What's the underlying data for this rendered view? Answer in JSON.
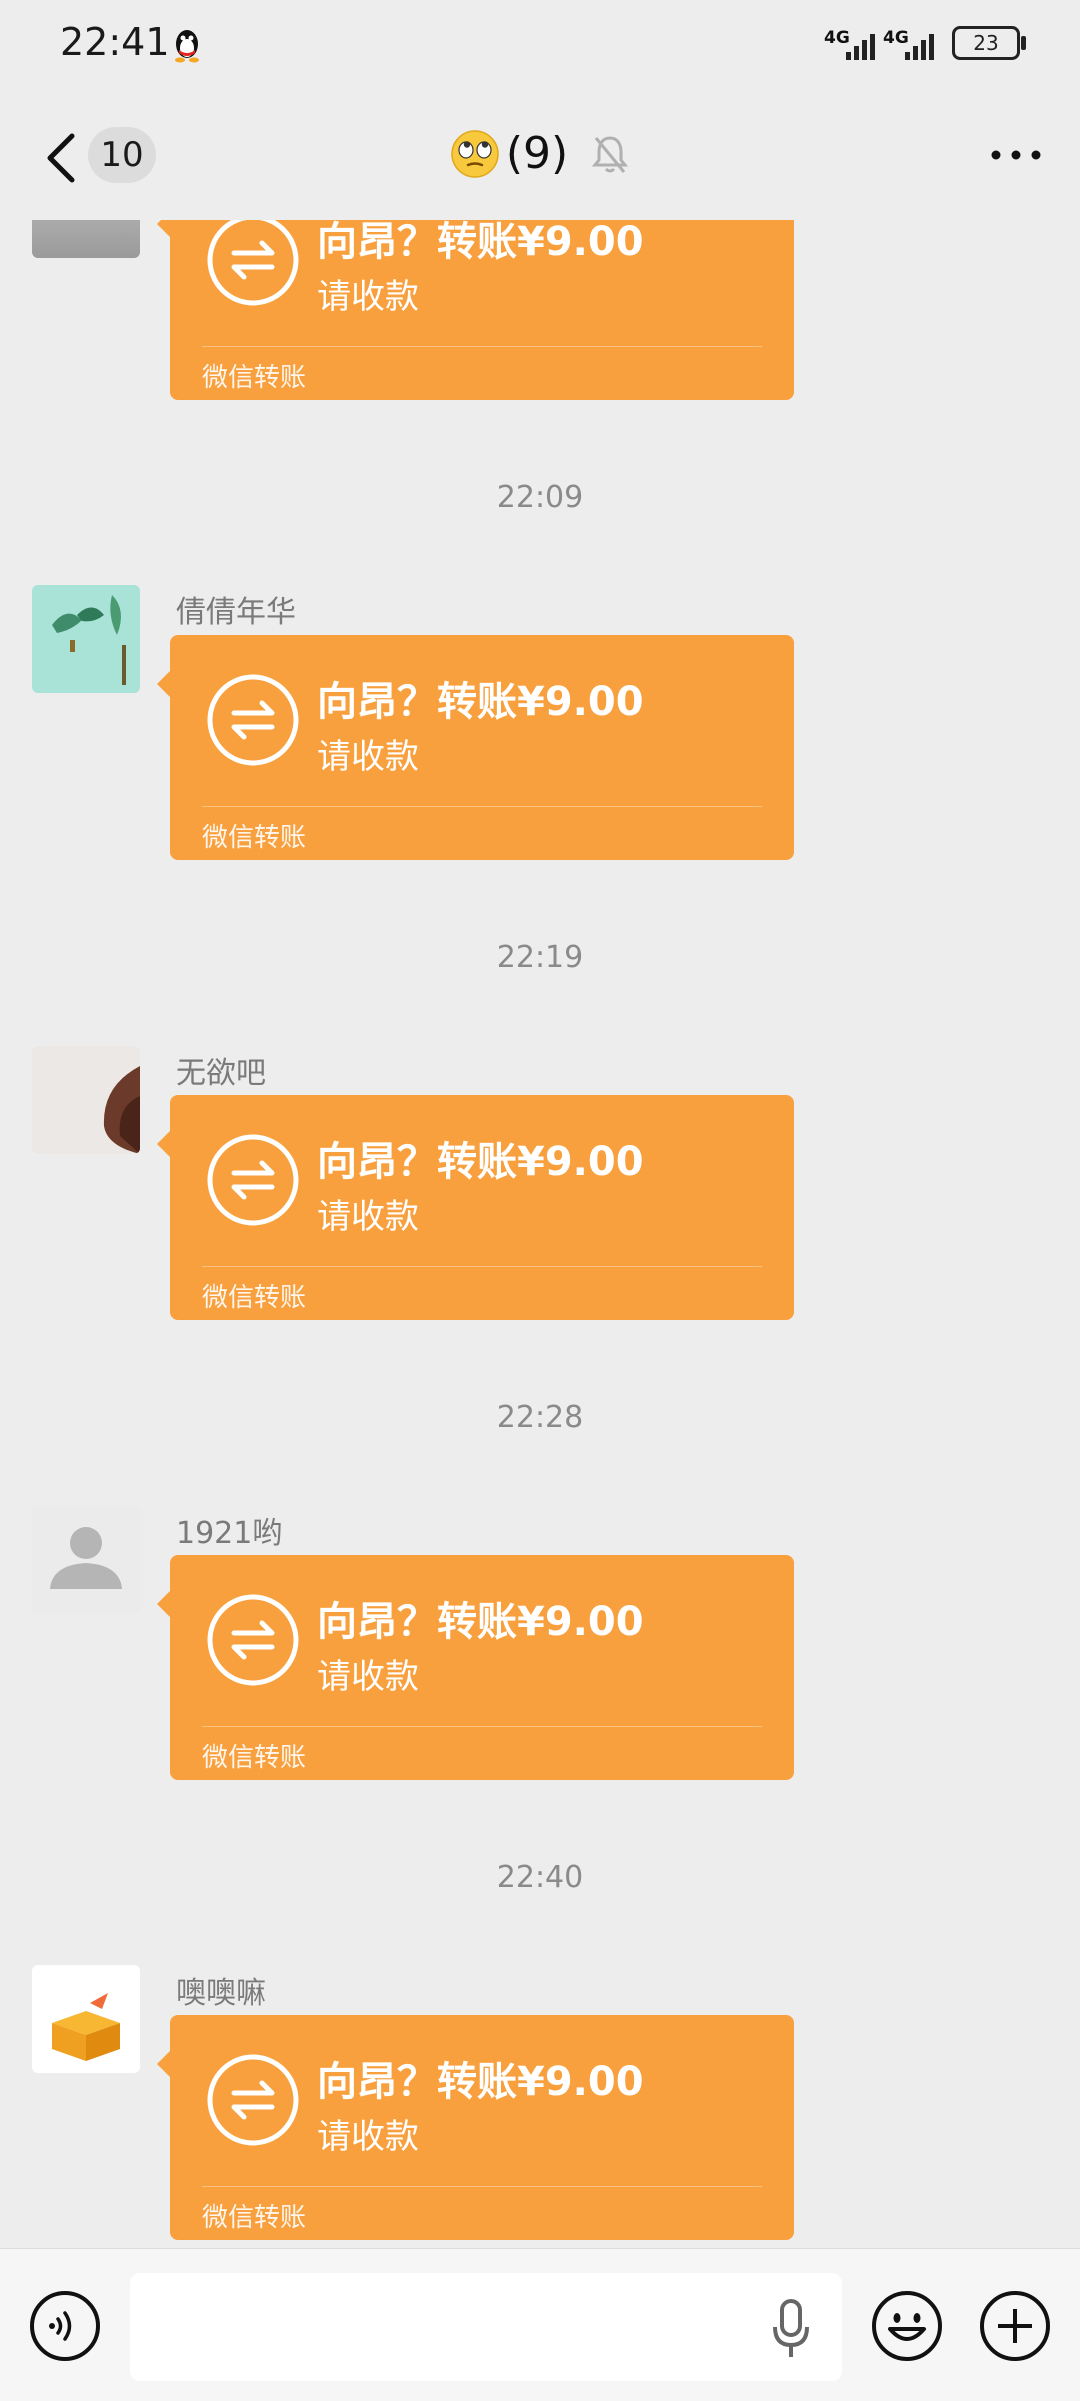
{
  "status_bar": {
    "time": "22:41",
    "network_1": "4G",
    "network_2": "4G",
    "battery": "23"
  },
  "header": {
    "back_count": "10",
    "title_emoji": "face-with-rolling-eyes",
    "title": "(9)",
    "muted": true
  },
  "messages": [
    {
      "timestamp": "",
      "sender": "",
      "avatar": "partial-avatar",
      "transfer_title": "向昂？转账¥9.00",
      "transfer_sub": "请收款",
      "transfer_footer": "微信转账"
    },
    {
      "timestamp": "22:09",
      "sender": "倩倩年华",
      "avatar": "plant-photo-avatar",
      "transfer_title": "向昂？转账¥9.00",
      "transfer_sub": "请收款",
      "transfer_footer": "微信转账"
    },
    {
      "timestamp": "22:19",
      "sender": "无欲吧",
      "avatar": "hair-photo-avatar",
      "transfer_title": "向昂？转账¥9.00",
      "transfer_sub": "请收款",
      "transfer_footer": "微信转账"
    },
    {
      "timestamp": "22:28",
      "sender": "1921哟",
      "avatar": "default-person-avatar",
      "transfer_title": "向昂？转账¥9.00",
      "transfer_sub": "请收款",
      "transfer_footer": "微信转账"
    },
    {
      "timestamp": "22:40",
      "sender": "噢噢嘛",
      "avatar": "gift-box-avatar",
      "transfer_title": "向昂？转账¥9.00",
      "transfer_sub": "请收款",
      "transfer_footer": "微信转账"
    }
  ],
  "input_bar": {
    "placeholder": ""
  },
  "colors": {
    "transfer_card": "#f9a03e",
    "background": "#ededed",
    "timestamp_text": "#8a8a8a"
  }
}
